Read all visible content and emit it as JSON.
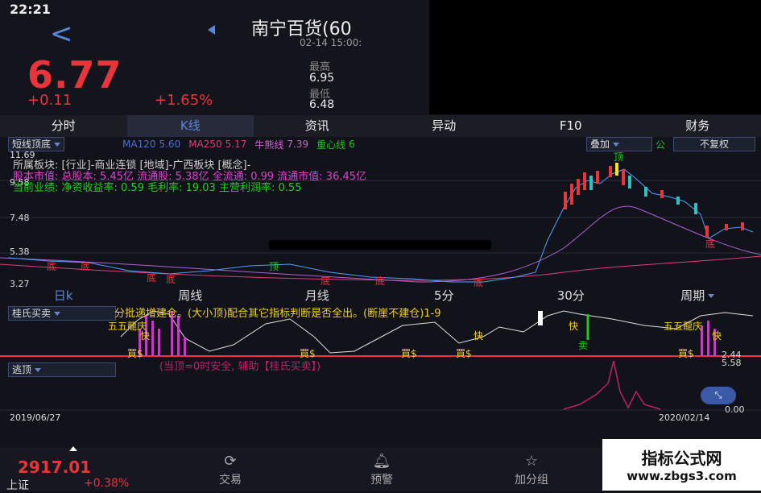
{
  "status": {
    "time": "22:21"
  },
  "header": {
    "stock_name": "南宁百货(60",
    "datetime": "02-14 15:00:"
  },
  "quote": {
    "price": "6.77",
    "change": "+0.11",
    "change_pct": "+1.65%",
    "high_label": "最高",
    "high": "6.95",
    "low_label": "最低",
    "low": "6.48"
  },
  "tabs": [
    "分时",
    "K线",
    "资讯",
    "异动",
    "F10",
    "财务"
  ],
  "active_tab": 1,
  "chart_controls": {
    "indicator": "短线顶底",
    "overlay_label": "叠加",
    "overlay_suffix": "公",
    "adjust": "不复权"
  },
  "ma_legend": [
    {
      "text": "MA120",
      "value": "5.60",
      "color": "#4d6fd0"
    },
    {
      "text": "MA250",
      "value": "5.17",
      "color": "#e03a78"
    },
    {
      "text": "牛熊线",
      "value": "7.39",
      "color": "#d060d0"
    },
    {
      "text": "重心线",
      "value": "6",
      "color": "#20c820"
    }
  ],
  "info_lines": [
    {
      "text": "所属板块: [行业]-商业连锁 [地域]-广西板块 [概念]-",
      "color": "#e0e0e0"
    },
    {
      "text": "股本市值: 总股本: 5.45亿 流通股: 5.38亿 全流通: 0.99 流通市值: 36.45亿",
      "color": "#e040d0"
    },
    {
      "text": "当前业绩: 净资收益率: 0.59 毛利率: 19.03 主营利润率: 0.55",
      "color": "#20d020"
    }
  ],
  "price_axis": [
    "11.69",
    "9.58",
    "7.48",
    "5.38",
    "3.27"
  ],
  "chart_marks": [
    "底",
    "底",
    "底",
    "底",
    "顶",
    "底",
    "底",
    "底",
    "顶",
    "底"
  ],
  "timeframes": [
    "日k",
    "周线",
    "月线",
    "5分",
    "30分",
    "周期"
  ],
  "active_timeframe": 0,
  "indicator1": {
    "name": "桂氏买卖",
    "scroll_text": "分批递增建仓。(大小顶)配合其它指标判断是否全出。(断崖不建仓)1-9",
    "labels": [
      "五五龍庆",
      "快",
      "快",
      "卖",
      "五五龍庆",
      "快",
      "快"
    ],
    "buy_label": "買$",
    "right_values": [
      "2.44",
      "5.58"
    ]
  },
  "indicator2": {
    "name": "逃顶",
    "note": "(当顶=0时安全, 辅助【桂氏买卖】)",
    "right_value": "0.00"
  },
  "date_range": {
    "start": "2019/06/27",
    "end": "2020/02/14"
  },
  "bottom_nav": {
    "index_value": "2917.01",
    "index_name": "上证",
    "index_change": "+0.38%",
    "items": [
      "交易",
      "预警",
      "加分组"
    ]
  },
  "watermark": {
    "title": "指标公式网",
    "url": "www.zbgs3.com"
  },
  "colors": {
    "up": "#e8353b",
    "accent": "#5a86d6",
    "bg": "#12131a"
  }
}
